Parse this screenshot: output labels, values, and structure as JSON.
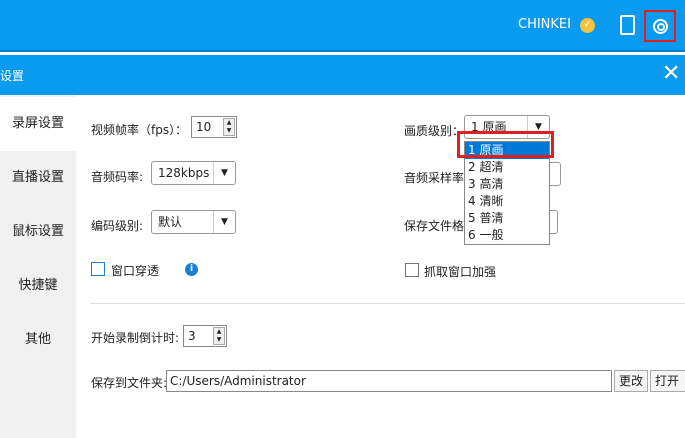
{
  "topbar": {
    "username": "CHINKEI",
    "badge_icon": "vip-badge-icon",
    "accent": "#0a9af0"
  },
  "dialog": {
    "title": "设置",
    "close": "✕"
  },
  "sidebar": {
    "items": [
      {
        "label": "录屏设置",
        "active": true
      },
      {
        "label": "直播设置"
      },
      {
        "label": "鼠标设置"
      },
      {
        "label": "快捷键"
      },
      {
        "label": "其他"
      }
    ]
  },
  "form": {
    "fps_label": "视频帧率（fps）：",
    "fps_value": "10",
    "audio_bitrate_label": "音频码率:",
    "audio_bitrate_value": "128kbps",
    "encode_level_label": "编码级别:",
    "encode_level_value": "默认",
    "window_through_label": "窗口穿透",
    "quality_label": "画质级别：",
    "quality_value": "1 原画",
    "quality_options": [
      "1 原画",
      "2 超清",
      "3 高清",
      "4 清晰",
      "5 普清",
      "6 一般"
    ],
    "sample_rate_label": "音频采样率",
    "save_format_label": "保存文件格",
    "capture_enhance_label": "抓取窗口加强",
    "countdown_label": "开始录制倒计时:",
    "countdown_value": "3",
    "save_to_label": "保存到文件夹:",
    "save_path": "C:/Users/Administrator",
    "change_button": "更改",
    "open_button": "打开"
  }
}
